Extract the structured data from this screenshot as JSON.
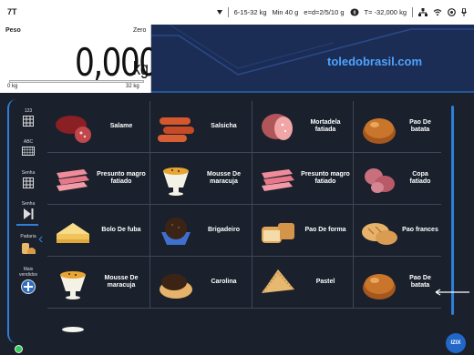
{
  "statusbar": {
    "time": "7T",
    "range": "6-15-32 kg",
    "min": "Min 40 g",
    "division": "e=d=2/5/10 g",
    "tare": "T= -32,000 kg"
  },
  "weight": {
    "label": "Peso",
    "zero_label": "Zero",
    "value": "0,000",
    "unit": "kg",
    "scale_min": "0 kg",
    "scale_max": "32 kg",
    "load_fraction": 0
  },
  "header": {
    "brand": "toledobrasil.com"
  },
  "rail": {
    "items": [
      {
        "label": "123",
        "icon": "keypad-icon"
      },
      {
        "label": "ABC",
        "icon": "keyboard-icon"
      },
      {
        "label": "Senha",
        "icon": "keypad-icon"
      },
      {
        "label": "Senha",
        "icon": "skip-icon"
      },
      {
        "label": "Padaria",
        "icon": "bread-icon"
      },
      {
        "label": "Mais vendidos",
        "icon": "star-icon"
      }
    ]
  },
  "products": [
    {
      "name": "Salame",
      "icon": "salami-icon"
    },
    {
      "name": "Salsicha",
      "icon": "sausage-icon"
    },
    {
      "name": "Mortadela fatiada",
      "icon": "mortadella-icon"
    },
    {
      "name": "Pao De batata",
      "icon": "potato-bread-icon"
    },
    {
      "name": "Presunto magro fatiado",
      "icon": "ham-slices-icon"
    },
    {
      "name": "Mousse De maracuja",
      "icon": "mousse-icon"
    },
    {
      "name": "Presunto magro fatiado",
      "icon": "ham-slices-icon"
    },
    {
      "name": "Copa fatiado",
      "icon": "copa-icon"
    },
    {
      "name": "Bolo De fuba",
      "icon": "cake-icon"
    },
    {
      "name": "Brigadeiro",
      "icon": "brigadeiro-icon"
    },
    {
      "name": "Pao De forma",
      "icon": "loaf-icon"
    },
    {
      "name": "Pao frances",
      "icon": "french-bread-icon"
    },
    {
      "name": "Mousse De maracuja",
      "icon": "mousse-icon"
    },
    {
      "name": "Carolina",
      "icon": "carolina-icon"
    },
    {
      "name": "Pastel",
      "icon": "pastel-icon"
    },
    {
      "name": "Pao De batata",
      "icon": "potato-bread-icon"
    }
  ],
  "badge": "IZIX"
}
